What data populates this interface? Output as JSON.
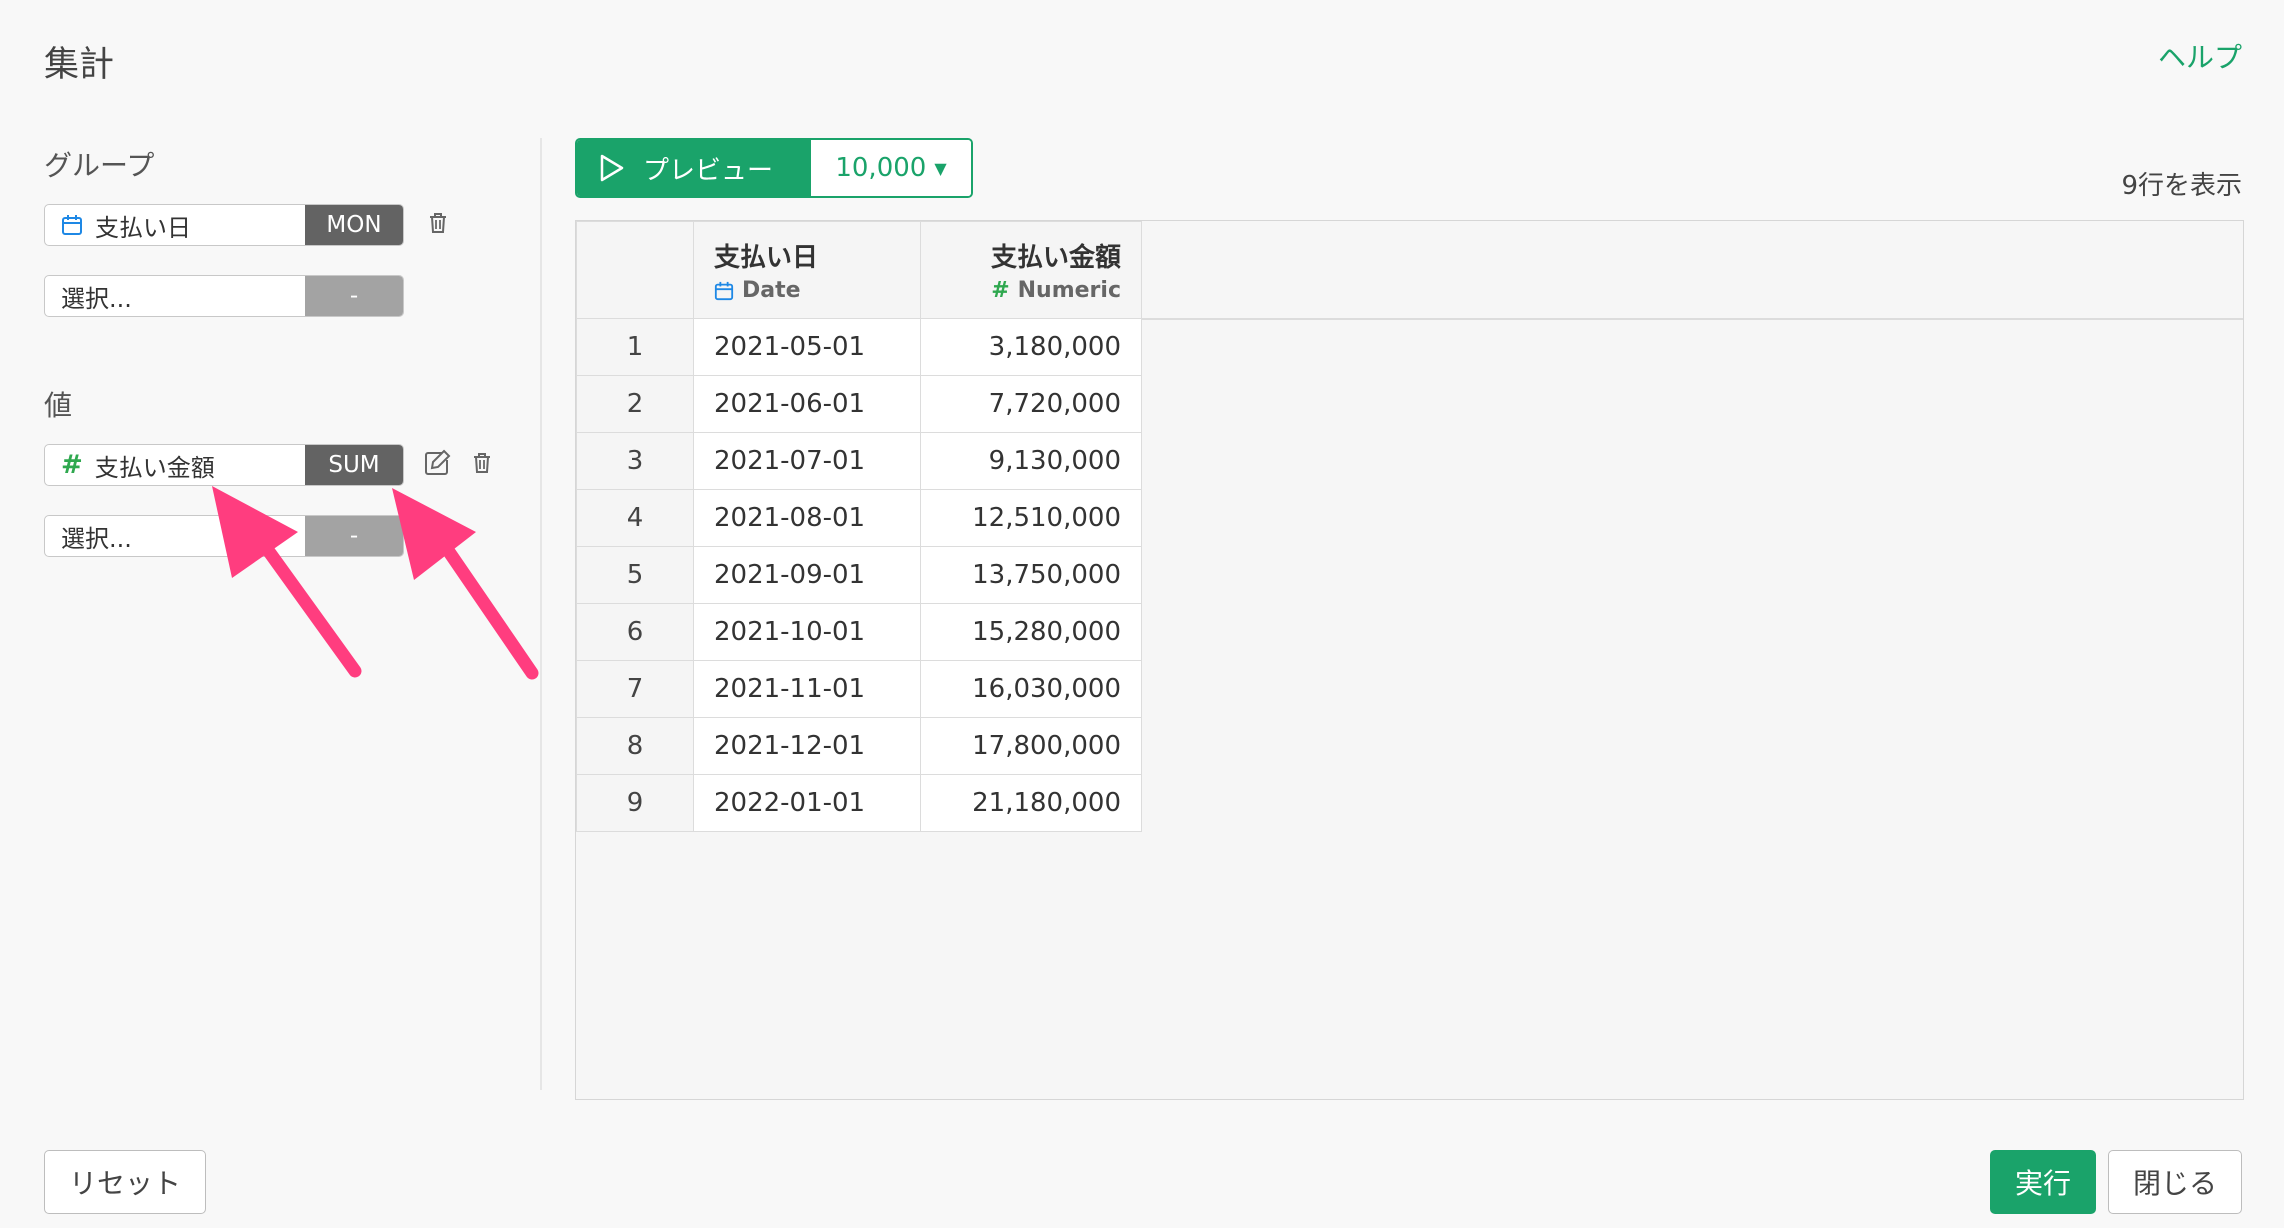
{
  "dialog": {
    "title": "集計",
    "help": "ヘルプ"
  },
  "left": {
    "group_label": "グループ",
    "group_field": {
      "name": "支払い日",
      "agg": "MON",
      "icon": "calendar-icon"
    },
    "group_select": {
      "placeholder": "選択...",
      "agg": "-"
    },
    "value_label": "値",
    "value_field": {
      "name": "支払い金額",
      "agg": "SUM",
      "icon": "hash-icon"
    },
    "value_select": {
      "placeholder": "選択...",
      "agg": "-"
    }
  },
  "preview": {
    "label": "プレビュー",
    "rows": "10,000",
    "row_count": "9行を表示"
  },
  "table": {
    "columns": [
      {
        "name": "支払い日",
        "type": "Date"
      },
      {
        "name": "支払い金額",
        "type": "Numeric"
      }
    ],
    "rows": [
      [
        "1",
        "2021-05-01",
        "3,180,000"
      ],
      [
        "2",
        "2021-06-01",
        "7,720,000"
      ],
      [
        "3",
        "2021-07-01",
        "9,130,000"
      ],
      [
        "4",
        "2021-08-01",
        "12,510,000"
      ],
      [
        "5",
        "2021-09-01",
        "13,750,000"
      ],
      [
        "6",
        "2021-10-01",
        "15,280,000"
      ],
      [
        "7",
        "2021-11-01",
        "16,030,000"
      ],
      [
        "8",
        "2021-12-01",
        "17,800,000"
      ],
      [
        "9",
        "2022-01-01",
        "21,180,000"
      ]
    ]
  },
  "footer": {
    "reset": "リセット",
    "run": "実行",
    "close": "閉じる"
  },
  "colors": {
    "accent": "#1aa36a",
    "annotation_arrow": "#ff3d7f",
    "date_icon": "#1e88e5",
    "numeric_icon": "#2fa84f"
  }
}
